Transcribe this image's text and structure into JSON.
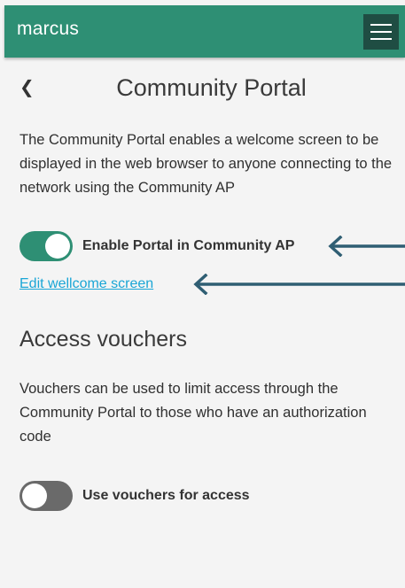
{
  "app_bar": {
    "brand": "marcus",
    "menu_icon": "hamburger-menu-icon"
  },
  "header": {
    "back_icon": "chevron-left-icon",
    "back_glyph": "❮",
    "title": "Community Portal"
  },
  "portal": {
    "description": "The Community Portal enables a welcome screen to be displayed in the web browser to anyone connecting to the network using the Community AP",
    "enable_toggle": {
      "label": "Enable Portal in Community AP",
      "state": "on"
    },
    "edit_link": "Edit wellcome screen"
  },
  "vouchers": {
    "title": "Access vouchers",
    "description": "Vouchers can be used to limit access through the Community Portal to those who have an authorization code",
    "toggle": {
      "label": "Use vouchers for access",
      "state": "off"
    }
  },
  "annotations": {
    "arrow_color": "#2f5e73",
    "arrow_icon": "left-arrow-icon"
  },
  "colors": {
    "primary": "#2e8f74",
    "menu_button": "#1f4d43",
    "link": "#1aa6d6",
    "toggle_off": "#6a6a6a",
    "background": "#f4f4f4"
  }
}
